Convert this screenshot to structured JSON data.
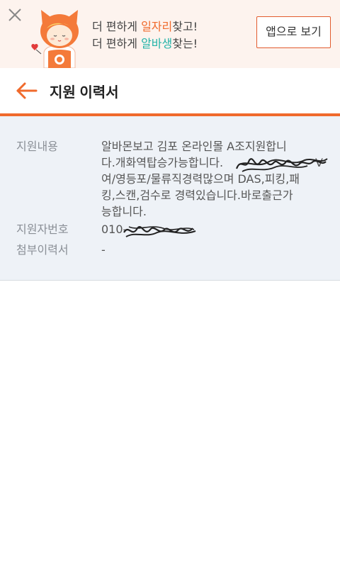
{
  "banner": {
    "line1_prefix": "더 편하게 ",
    "line1_highlight": "일자리",
    "line1_suffix": "찾고!",
    "line2_prefix": "더 편하게 ",
    "line2_highlight": "알바생",
    "line2_suffix": "찾는!",
    "app_button_label": "앱으로 보기",
    "highlight_color_1": "#f06a2c",
    "highlight_color_2": "#22b3a8",
    "close_icon": "close-icon",
    "mascot": "mascot-illustration"
  },
  "header": {
    "title": "지원 이력서",
    "back_icon": "arrow-left-icon",
    "accent_color": "#f06a2c"
  },
  "details": {
    "content_label": "지원내용",
    "content_lines": [
      "알바몬보고 김포 온라인몰 A조지원합니",
      "다.개화역탑승가능합니다.",
      "여/영등포/물류직경력많으며 DAS,피킹,패",
      "킹,스캔,검수로 경력있습니다.바로출근가",
      "능합니다."
    ],
    "content_line2_tail": "V",
    "phone_label": "지원자번호",
    "phone_value": "010-",
    "resume_label": "첨부이력서",
    "resume_value": "-"
  }
}
